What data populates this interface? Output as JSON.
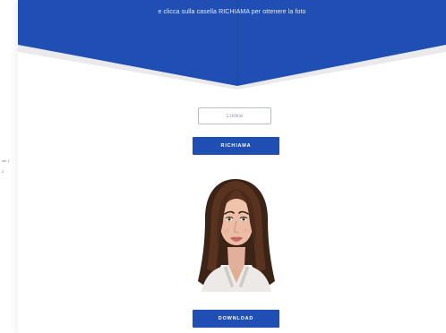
{
  "banner": {
    "text": "e clicca sulla casella RICHIAMA per ottenere la foto",
    "color": "#1f4fb3"
  },
  "sidebar": {
    "line1": "ine 1",
    "line2": "2"
  },
  "code_input": {
    "placeholder": "Codice"
  },
  "buttons": {
    "richiama": "RICHIAMA",
    "download": "DOWNLOAD"
  },
  "photo": {
    "alt": "Fototessera - ritratto di donna"
  }
}
